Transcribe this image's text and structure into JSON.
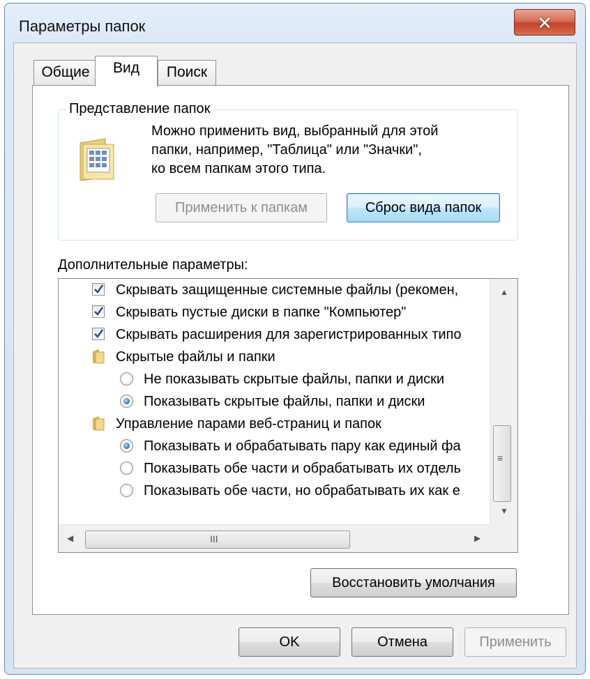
{
  "window": {
    "title": "Параметры папок",
    "close_glyph": "✕"
  },
  "tabs": [
    {
      "label": "Общие",
      "active": false
    },
    {
      "label": "Вид",
      "active": true
    },
    {
      "label": "Поиск",
      "active": false
    }
  ],
  "folder_view": {
    "group_label": "Представление папок",
    "description_lines": [
      "Можно применить вид, выбранный для этой",
      "папки, например, \"Таблица\" или \"Значки\",",
      "ко всем папкам этого типа."
    ],
    "apply_button": "Применить к папкам",
    "reset_button": "Сброс вида папок"
  },
  "advanced": {
    "label": "Дополнительные параметры:",
    "items": [
      {
        "type": "checkbox",
        "checked": true,
        "label": "Скрывать защищенные системные файлы (рекомен,"
      },
      {
        "type": "checkbox",
        "checked": true,
        "label": "Скрывать пустые диски в папке \"Компьютер\""
      },
      {
        "type": "checkbox",
        "checked": true,
        "label": "Скрывать расширения для зарегистрированных типо"
      },
      {
        "type": "folder",
        "label": "Скрытые файлы и папки"
      },
      {
        "type": "radio",
        "checked": false,
        "label": "Не показывать скрытые файлы, папки и диски"
      },
      {
        "type": "radio",
        "checked": true,
        "label": "Показывать скрытые файлы, папки и диски"
      },
      {
        "type": "folder",
        "label": "Управление парами веб-страниц и папок"
      },
      {
        "type": "radio",
        "checked": true,
        "label": "Показывать и обрабатывать пару как единый фа"
      },
      {
        "type": "radio",
        "checked": false,
        "label": "Показывать обе части и обрабатывать их отдель"
      },
      {
        "type": "radio",
        "checked": false,
        "label": "Показывать обе части, но обрабатывать их как е"
      }
    ],
    "restore_button": "Восстановить умолчания",
    "hscroll_grip": "III",
    "vscroll_grip": "≡"
  },
  "footer": {
    "ok": "OK",
    "cancel": "Отмена",
    "apply": "Применить"
  },
  "colors": {
    "accent": "#3c7fb1",
    "close": "#c1442b"
  }
}
